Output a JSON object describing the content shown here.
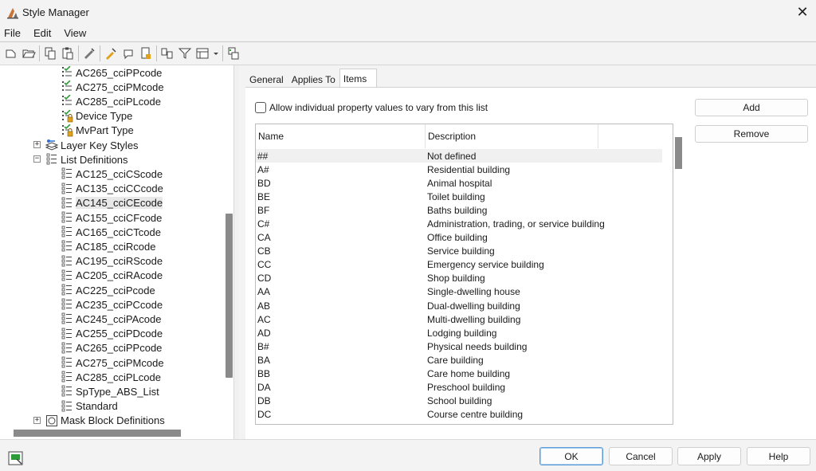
{
  "window": {
    "title": "Style Manager",
    "close_glyph": "✕"
  },
  "menubar": {
    "items": [
      "File",
      "Edit",
      "View"
    ]
  },
  "toolbar": {
    "icons": [
      "new-icon",
      "open-icon",
      "copy-icon",
      "paste-icon",
      "purge-icon",
      "edit-style-icon",
      "set-from-icon",
      "toggle-icon",
      "compare-icon",
      "filter-icon",
      "view-options-icon",
      "dropdown-arrow-icon",
      "inherit-icon"
    ]
  },
  "tree": {
    "items": [
      {
        "label": "AC265_cciPPcode",
        "icon": "property-set-icon",
        "level": 2
      },
      {
        "label": "AC275_cciPMcode",
        "icon": "property-set-icon",
        "level": 2
      },
      {
        "label": "AC285_cciPLcode",
        "icon": "property-set-icon",
        "level": 2
      },
      {
        "label": "Device Type",
        "icon": "property-set-locked-icon",
        "level": 2
      },
      {
        "label": "MvPart Type",
        "icon": "property-set-locked-icon",
        "level": 2
      },
      {
        "label": "Layer Key Styles",
        "icon": "layer-key-icon",
        "level": 1,
        "expander": "+"
      },
      {
        "label": "List Definitions",
        "icon": "list-definition-icon",
        "level": 1,
        "expander": "−"
      },
      {
        "label": "AC125_cciCScode",
        "icon": "list-definition-icon",
        "level": 2
      },
      {
        "label": "AC135_cciCCcode",
        "icon": "list-definition-icon",
        "level": 2
      },
      {
        "label": "AC145_cciCEcode",
        "icon": "list-definition-icon",
        "level": 2,
        "selected": true
      },
      {
        "label": "AC155_cciCFcode",
        "icon": "list-definition-icon",
        "level": 2
      },
      {
        "label": "AC165_cciCTcode",
        "icon": "list-definition-icon",
        "level": 2
      },
      {
        "label": "AC185_cciRcode",
        "icon": "list-definition-icon",
        "level": 2
      },
      {
        "label": "AC195_cciRScode",
        "icon": "list-definition-icon",
        "level": 2
      },
      {
        "label": "AC205_cciRAcode",
        "icon": "list-definition-icon",
        "level": 2
      },
      {
        "label": "AC225_cciPcode",
        "icon": "list-definition-icon",
        "level": 2
      },
      {
        "label": "AC235_cciPCcode",
        "icon": "list-definition-icon",
        "level": 2
      },
      {
        "label": "AC245_cciPAcode",
        "icon": "list-definition-icon",
        "level": 2
      },
      {
        "label": "AC255_cciPDcode",
        "icon": "list-definition-icon",
        "level": 2
      },
      {
        "label": "AC265_cciPPcode",
        "icon": "list-definition-icon",
        "level": 2
      },
      {
        "label": "AC275_cciPMcode",
        "icon": "list-definition-icon",
        "level": 2
      },
      {
        "label": "AC285_cciPLcode",
        "icon": "list-definition-icon",
        "level": 2
      },
      {
        "label": "SpType_ABS_List",
        "icon": "list-definition-icon",
        "level": 2
      },
      {
        "label": "Standard",
        "icon": "list-definition-icon",
        "level": 2
      },
      {
        "label": "Mask Block Definitions",
        "icon": "mask-block-icon",
        "level": 1,
        "expander": "+"
      }
    ]
  },
  "tabs": [
    {
      "label": "General",
      "active": false
    },
    {
      "label": "Applies To",
      "active": false
    },
    {
      "label": "Items",
      "active": true
    }
  ],
  "items_tab": {
    "allow_vary_label": "Allow individual property values to vary from this list",
    "allow_vary_checked": false,
    "add_label": "Add",
    "remove_label": "Remove",
    "columns": [
      "Name",
      "Description"
    ],
    "rows": [
      [
        "##",
        "Not defined"
      ],
      [
        "A#",
        "Residential building"
      ],
      [
        "BD",
        "Animal hospital"
      ],
      [
        "BE",
        "Toilet building"
      ],
      [
        "BF",
        "Baths building"
      ],
      [
        "C#",
        "Administration, trading, or service building"
      ],
      [
        "CA",
        "Office building"
      ],
      [
        "CB",
        "Service building"
      ],
      [
        "CC",
        "Emergency service building"
      ],
      [
        "CD",
        "Shop building"
      ],
      [
        "AA",
        "Single-dwelling house"
      ],
      [
        "AB",
        "Dual-dwelling building"
      ],
      [
        "AC",
        "Multi-dwelling building"
      ],
      [
        "AD",
        "Lodging building"
      ],
      [
        "B#",
        "Physical needs building"
      ],
      [
        "BA",
        "Care building"
      ],
      [
        "BB",
        "Care home building"
      ],
      [
        "DA",
        "Preschool building"
      ],
      [
        "DB",
        "School building"
      ],
      [
        "DC",
        "Course centre building"
      ]
    ]
  },
  "dialog_buttons": {
    "ok": "OK",
    "cancel": "Cancel",
    "apply": "Apply",
    "help": "Help"
  },
  "colors": {
    "accent": "#5b9bd5",
    "scroll_thumb": "#8a8a8a",
    "icon_green": "#2e9c3a",
    "icon_lock": "#e0a21b"
  }
}
